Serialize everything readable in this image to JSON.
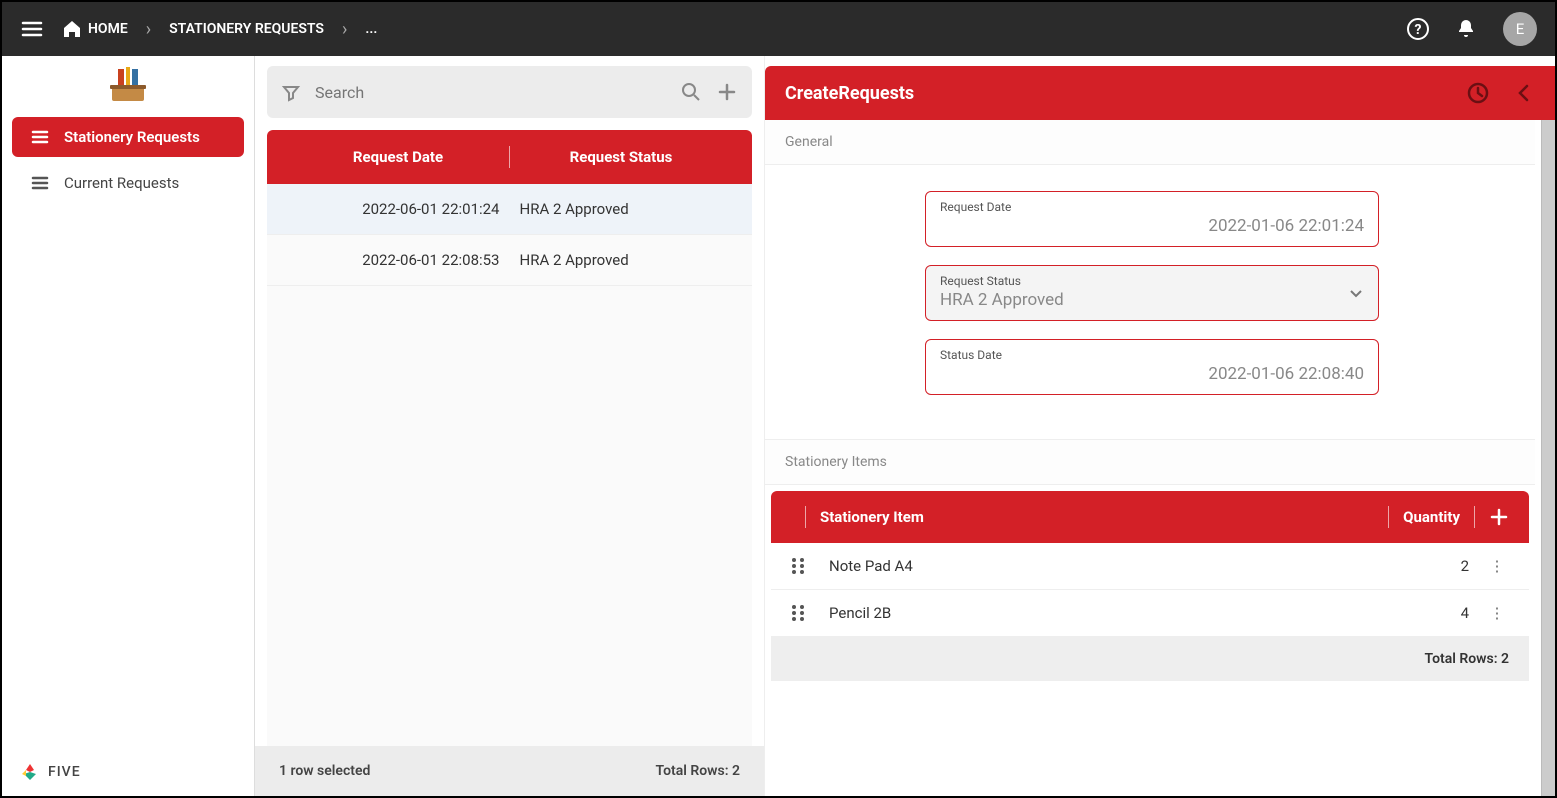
{
  "topbar": {
    "breadcrumbs": [
      "HOME",
      "STATIONERY REQUESTS",
      "..."
    ],
    "avatar_initial": "E"
  },
  "sidebar": {
    "items": [
      {
        "label": "Stationery Requests",
        "active": true
      },
      {
        "label": "Current Requests",
        "active": false
      }
    ],
    "footer_brand": "FIVE"
  },
  "list": {
    "search_placeholder": "Search",
    "columns": [
      "Request Date",
      "Request Status"
    ],
    "rows": [
      {
        "date": "2022-06-01 22:01:24",
        "status": "HRA 2 Approved",
        "selected": true
      },
      {
        "date": "2022-06-01 22:08:53",
        "status": "HRA 2 Approved",
        "selected": false
      }
    ],
    "footer_left": "1 row selected",
    "footer_right": "Total Rows: 2"
  },
  "detail": {
    "title": "CreateRequests",
    "section_general": "General",
    "fields": {
      "request_date": {
        "label": "Request Date",
        "value": "2022-01-06 22:01:24"
      },
      "request_status": {
        "label": "Request Status",
        "value": "HRA 2 Approved"
      },
      "status_date": {
        "label": "Status Date",
        "value": "2022-01-06 22:08:40"
      }
    },
    "section_items": "Stationery Items",
    "items_columns": {
      "item": "Stationery Item",
      "qty": "Quantity"
    },
    "items": [
      {
        "name": "Note Pad A4",
        "qty": "2"
      },
      {
        "name": "Pencil 2B",
        "qty": "4"
      }
    ],
    "items_footer": "Total Rows: 2"
  }
}
